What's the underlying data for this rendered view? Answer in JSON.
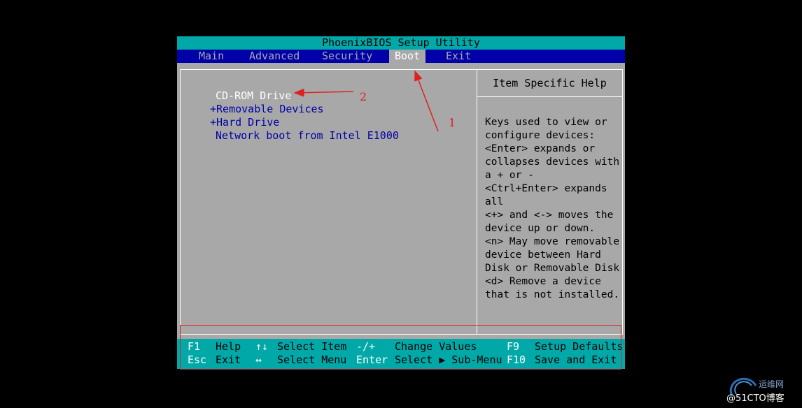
{
  "title": "PhoenixBIOS Setup Utility",
  "menu": [
    {
      "label": "Main"
    },
    {
      "label": "Advanced"
    },
    {
      "label": "Security"
    },
    {
      "label": "Boot"
    },
    {
      "label": "Exit"
    }
  ],
  "active_menu": "Boot",
  "boot_items": [
    {
      "label": "CD-ROM Drive"
    },
    {
      "label": "+Removable Devices"
    },
    {
      "label": "+Hard Drive"
    },
    {
      "label": "Network boot from Intel E1000"
    }
  ],
  "help": {
    "title": "Item Specific Help",
    "text": "Keys used to view or\nconfigure devices:\n<Enter> expands or\ncollapses devices with\na + or -\n<Ctrl+Enter> expands\nall\n<+> and <-> moves the\ndevice up or down.\n<n> May move removable\ndevice between Hard\nDisk or Removable Disk\n<d> Remove a device\nthat is not installed."
  },
  "footer": {
    "row1": [
      {
        "key": "F1",
        "desc": "Help"
      },
      {
        "key": "↑↓",
        "desc": "Select Item"
      },
      {
        "key": "-/+",
        "desc": "Change Values"
      },
      {
        "key": "F9",
        "desc": "Setup Defaults"
      }
    ],
    "row2": [
      {
        "key": "Esc",
        "desc": "Exit"
      },
      {
        "key": "↔",
        "desc": "Select Menu"
      },
      {
        "key": "Enter",
        "desc": "Select ▶ Sub-Menu"
      },
      {
        "key": "F10",
        "desc": "Save and Exit"
      }
    ]
  },
  "annotations": {
    "label_1": "1",
    "label_2": "2",
    "color": "#e02020"
  },
  "watermark": {
    "top": "运维网",
    "bottom": "@51CTO博客"
  },
  "colors": {
    "cyan": "#00a8a8",
    "blue": "#0000a8",
    "gray": "#a8a8a8"
  }
}
